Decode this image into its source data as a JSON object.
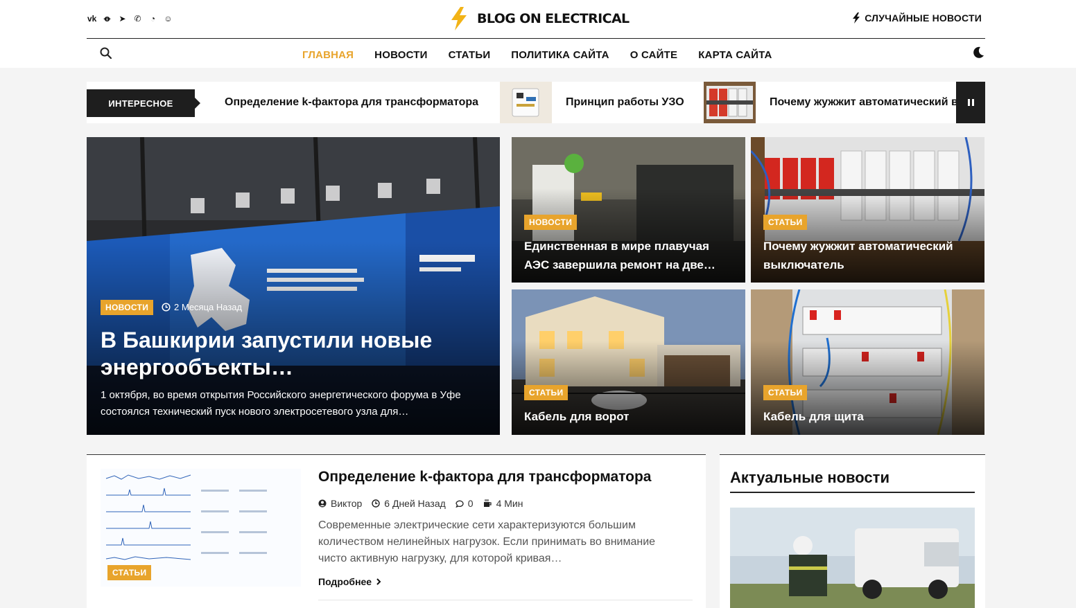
{
  "header": {
    "logo_text": "BLOG ON ELECTRICAL",
    "random_news": "Случайные новости",
    "social_icons": [
      "vk-icon",
      "odnoklassniki-icon",
      "telegram-icon",
      "viber-icon",
      "whatsapp-icon",
      "dzen-icon"
    ]
  },
  "nav": {
    "items": [
      "Главная",
      "Новости",
      "Статьи",
      "Политика сайта",
      "О сайте",
      "Карта сайта"
    ],
    "active_color": "#e8a42c"
  },
  "ticker": {
    "label": "ИНТЕРЕСНОЕ",
    "items": [
      "Определение k-фактора для трансформатора",
      "Принцип работы УЗО",
      "Почему жужжит автоматический выключатель"
    ]
  },
  "hero": {
    "badge": "НОВОСТИ",
    "time": "2 Месяца Назад",
    "title": "В Башкирии запустили новые энергообъекты…",
    "excerpt": "1 октября, во время открытия Российского энергетического форума в Уфе состоялся технический пуск нового электросетевого узла для…"
  },
  "grid": [
    {
      "badge": "НОВОСТИ",
      "title": "Единственная в мире плавучая АЭС завершила ремонт на две…"
    },
    {
      "badge": "СТАТЬИ",
      "title": "Почему жужжит автоматический выключатель"
    },
    {
      "badge": "СТАТЬИ",
      "title": "Кабель для ворот"
    },
    {
      "badge": "СТАТЬИ",
      "title": "Кабель для щита"
    }
  ],
  "article": {
    "badge": "СТАТЬИ",
    "title": "Определение k-фактора для трансформатора",
    "author": "Виктор",
    "date": "6 Дней Назад",
    "comments": "0",
    "read_time": "4 Мин",
    "excerpt": "Современные электрические сети характеризуются большим количеством нелинейных нагрузок. Если принимать во внимание чисто активную нагрузку, для которой кривая…",
    "more": "Подробнее"
  },
  "sidebar": {
    "title": "Актуальные новости"
  },
  "colors": {
    "accent": "#e8a42c",
    "dark": "#1e1e1e",
    "page_bg": "#f4f4f4"
  }
}
